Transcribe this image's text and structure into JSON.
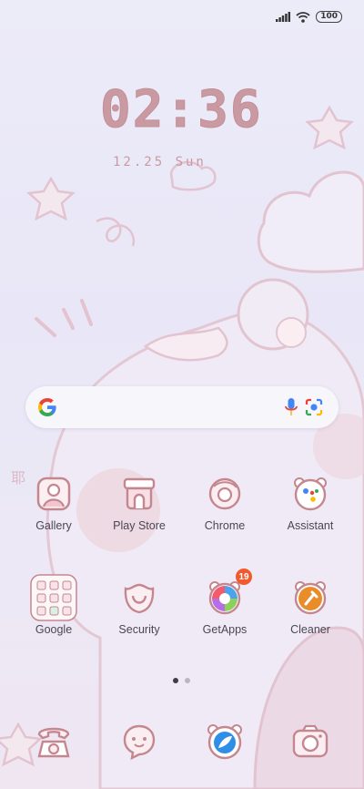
{
  "status": {
    "battery": "100",
    "icons": [
      "signal-icon",
      "wifi-icon",
      "battery-icon"
    ]
  },
  "lockface": {
    "time": "02:36",
    "date": "12.25 Sun"
  },
  "search": {
    "icons": [
      "google-g-icon",
      "microphone-icon",
      "google-lens-icon"
    ]
  },
  "apps": [
    {
      "label": "Gallery",
      "icon": "gallery-icon"
    },
    {
      "label": "Play Store",
      "icon": "play-store-icon"
    },
    {
      "label": "Chrome",
      "icon": "chrome-icon"
    },
    {
      "label": "Assistant",
      "icon": "assistant-icon"
    },
    {
      "label": "Google",
      "icon": "google-folder-icon"
    },
    {
      "label": "Security",
      "icon": "security-icon"
    },
    {
      "label": "GetApps",
      "icon": "getapps-icon",
      "badge": "19"
    },
    {
      "label": "Cleaner",
      "icon": "cleaner-icon"
    }
  ],
  "dock": [
    {
      "icon": "phone-icon"
    },
    {
      "icon": "messages-icon"
    },
    {
      "icon": "browser-icon"
    },
    {
      "icon": "camera-icon"
    }
  ],
  "page_indicator": {
    "pages": 2,
    "current": 1
  },
  "colors": {
    "accent": "#c99aa2",
    "badge": "#f05a2d",
    "outline": "#c4878f"
  }
}
